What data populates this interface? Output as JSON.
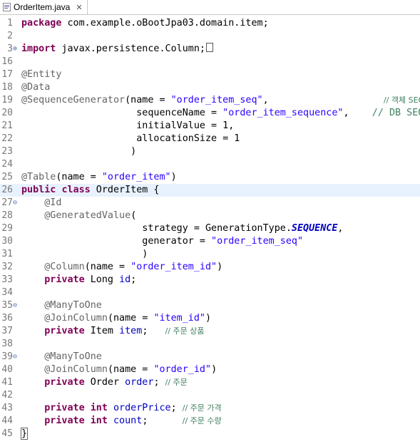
{
  "tab": {
    "filename": "OrderItem.java",
    "close_glyph": "✕"
  },
  "lines": [
    {
      "n": "1",
      "fold": "",
      "html": "<span class='k'>package</span> com.example.oBootJpa03.domain.item;"
    },
    {
      "n": "2",
      "fold": "",
      "html": ""
    },
    {
      "n": "3",
      "fold": "⊕",
      "html": "<span class='k'>import</span> javax.persistence.Column;<span class='box'></span>"
    },
    {
      "n": "16",
      "fold": "",
      "html": ""
    },
    {
      "n": "17",
      "fold": "",
      "html": "<span class='a'>@Entity</span>"
    },
    {
      "n": "18",
      "fold": "",
      "html": "<span class='a'>@Data</span>"
    },
    {
      "n": "19",
      "fold": "",
      "html": "<span class='a'>@SequenceGenerator</span>(name = <span class='s'>\"order_item_seq\"</span>,                    <span class='c'>// 객체 SEQ</span>"
    },
    {
      "n": "20",
      "fold": "",
      "html": "                    sequenceName = <span class='s'>\"order_item_sequence\"</span>,    <span class='cm'>// DB SEQ</span>"
    },
    {
      "n": "21",
      "fold": "",
      "html": "                    initialValue = 1,"
    },
    {
      "n": "22",
      "fold": "",
      "html": "                    allocationSize = 1"
    },
    {
      "n": "23",
      "fold": "",
      "html": "                   )"
    },
    {
      "n": "24",
      "fold": "",
      "html": ""
    },
    {
      "n": "25",
      "fold": "",
      "html": "<span class='a'>@Table</span>(name = <span class='s'>\"order_item\"</span>)"
    },
    {
      "n": "26",
      "fold": "",
      "html": "<span class='k'>public</span> <span class='k'>class</span> OrderItem {",
      "current": true
    },
    {
      "n": "27",
      "fold": "⊖",
      "html": "    <span class='a'>@Id</span>"
    },
    {
      "n": "28",
      "fold": "",
      "html": "    <span class='a'>@GeneratedValue</span>("
    },
    {
      "n": "29",
      "fold": "",
      "html": "                     strategy = GenerationType.<span class='sf'>SEQUENCE</span>,"
    },
    {
      "n": "30",
      "fold": "",
      "html": "                     generator = <span class='s'>\"order_item_seq\"</span>"
    },
    {
      "n": "31",
      "fold": "",
      "html": "                     )"
    },
    {
      "n": "32",
      "fold": "",
      "html": "    <span class='a'>@Column</span>(name = <span class='s'>\"order_item_id\"</span>)"
    },
    {
      "n": "33",
      "fold": "",
      "html": "    <span class='k'>private</span> Long <span class='f'>id</span>;"
    },
    {
      "n": "34",
      "fold": "",
      "html": ""
    },
    {
      "n": "35",
      "fold": "⊖",
      "html": "    <span class='a'>@ManyToOne</span>"
    },
    {
      "n": "36",
      "fold": "",
      "html": "    <span class='a'>@JoinColumn</span>(name = <span class='s'>\"item_id\"</span>)"
    },
    {
      "n": "37",
      "fold": "",
      "html": "    <span class='k'>private</span> Item <span class='f'>item</span>;   <span class='c'>// 주문 상품</span>"
    },
    {
      "n": "38",
      "fold": "",
      "html": ""
    },
    {
      "n": "39",
      "fold": "⊖",
      "html": "    <span class='a'>@ManyToOne</span>"
    },
    {
      "n": "40",
      "fold": "",
      "html": "    <span class='a'>@JoinColumn</span>(name = <span class='s'>\"order_id\"</span>)"
    },
    {
      "n": "41",
      "fold": "",
      "html": "    <span class='k'>private</span> Order <span class='f'>order</span>; <span class='c'>// 주문</span>"
    },
    {
      "n": "42",
      "fold": "",
      "html": ""
    },
    {
      "n": "43",
      "fold": "",
      "html": "    <span class='k'>private</span> <span class='k'>int</span> <span class='f'>orderPrice</span>; <span class='c'>// 주문 가격</span>"
    },
    {
      "n": "44",
      "fold": "",
      "html": "    <span class='k'>private</span> <span class='k'>int</span> <span class='f'>count</span>;      <span class='c'>// 주문 수량</span>"
    },
    {
      "n": "45",
      "fold": "",
      "html": "<span class='cursor-brace'>}</span>"
    }
  ]
}
